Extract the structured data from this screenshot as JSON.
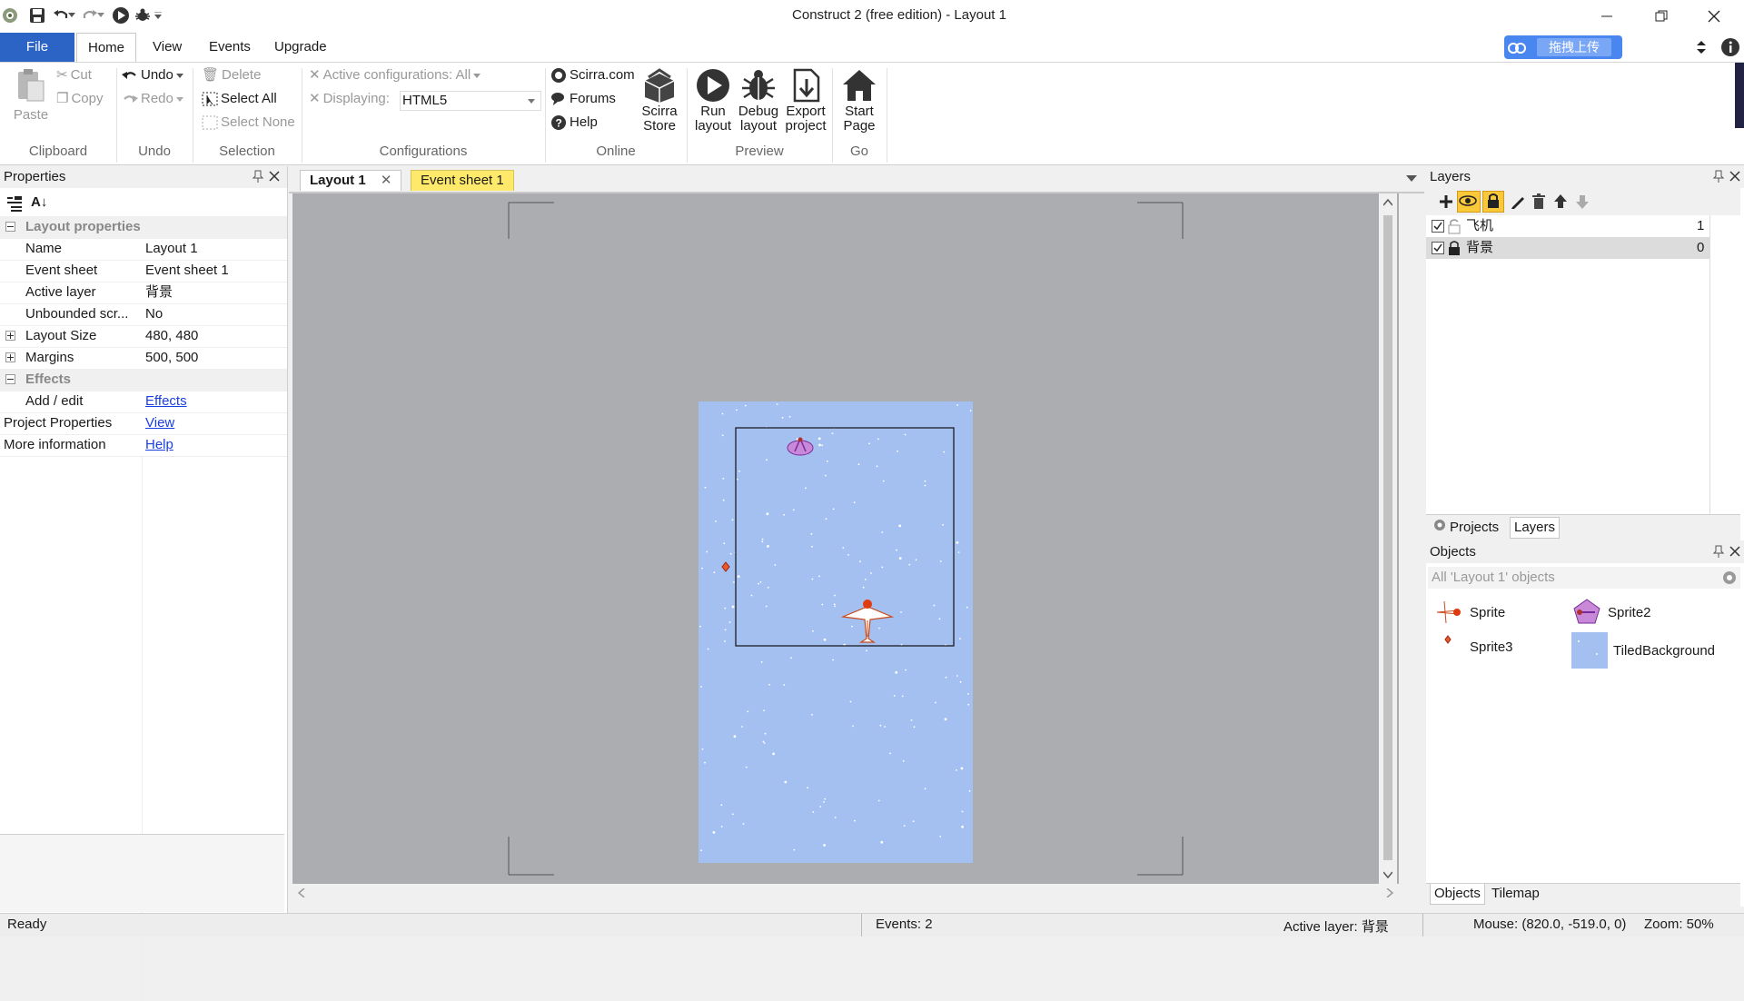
{
  "window": {
    "title": "Construct 2  (free edition) - Layout 1"
  },
  "ribbon_tabs": [
    "File",
    "Home",
    "View",
    "Events",
    "Upgrade"
  ],
  "upload_badge": "拖拽上传",
  "ribbon": {
    "clipboard": {
      "paste": "Paste",
      "cut": "Cut",
      "copy": "Copy",
      "label": "Clipboard"
    },
    "undo": {
      "undo": "Undo",
      "redo": "Redo",
      "label": "Undo"
    },
    "selection": {
      "delete": "Delete",
      "select_all": "Select All",
      "select_none": "Select None",
      "label": "Selection"
    },
    "configurations": {
      "active": "Active configurations: All",
      "displaying_label": "Displaying:",
      "displaying_value": "HTML5",
      "label": "Configurations"
    },
    "online": {
      "scirra": "Scirra.com",
      "forums": "Forums",
      "help": "Help",
      "store_line1": "Scirra",
      "store_line2": "Store",
      "label": "Online"
    },
    "preview": {
      "run_l1": "Run",
      "run_l2": "layout",
      "debug_l1": "Debug",
      "debug_l2": "layout",
      "export_l1": "Export",
      "export_l2": "project",
      "label": "Preview"
    },
    "go": {
      "start_l1": "Start",
      "start_l2": "Page",
      "label": "Go"
    }
  },
  "properties": {
    "title": "Properties",
    "layout_category": "Layout properties",
    "rows": [
      {
        "name": "Name",
        "value": "Layout 1"
      },
      {
        "name": "Event sheet",
        "value": "Event sheet 1"
      },
      {
        "name": "Active layer",
        "value": "背景"
      },
      {
        "name": "Unbounded scr...",
        "value": "No"
      },
      {
        "name": "Layout Size",
        "value": "480, 480"
      },
      {
        "name": "Margins",
        "value": "500, 500"
      }
    ],
    "effects_category": "Effects",
    "add_edit": "Add / edit",
    "effects_link": "Effects",
    "project_properties": "Project Properties",
    "view_link": "View",
    "more_info": "More information",
    "help_link": "Help"
  },
  "doc_tabs": {
    "layout": "Layout 1",
    "event_sheet": "Event sheet 1"
  },
  "layers": {
    "title": "Layers",
    "items": [
      {
        "name": "飞机",
        "index": "1"
      },
      {
        "name": "背景",
        "index": "0"
      }
    ],
    "bottom_tabs": [
      "Projects",
      "Layers"
    ]
  },
  "objects": {
    "title": "Objects",
    "filter": "All 'Layout 1' objects",
    "items": [
      "Sprite",
      "Sprite2",
      "Sprite3",
      "TiledBackground"
    ],
    "bottom_tabs": [
      "Objects",
      "Tilemap"
    ]
  },
  "status": {
    "ready": "Ready",
    "events": "Events: 2",
    "active_layer": "Active layer: 背景",
    "mouse": "Mouse: (820.0, -519.0, 0)",
    "zoom": "Zoom: 50%"
  },
  "colors": {
    "accent": "#2b64c5",
    "canvas_bg": "#acadb1",
    "tiled_bg": "#a4c0f0",
    "event_tab": "#ffe96a"
  }
}
